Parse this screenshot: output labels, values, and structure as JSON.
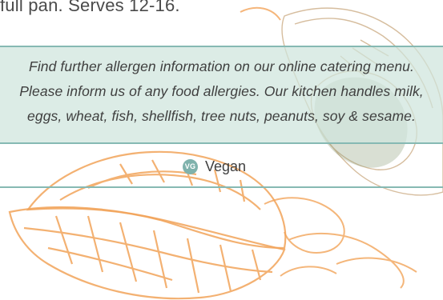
{
  "intro": {
    "serving_text": "full pan. Serves 12-16."
  },
  "allergen_notice": {
    "lines": [
      "Find further allergen information on our online catering menu.",
      "Please inform us of any food allergies. Our kitchen handles milk,",
      "eggs, wheat, fish, shellfish, tree nuts, peanuts, soy & sesame."
    ]
  },
  "legend": {
    "icon_text": "VG",
    "label": "Vegan"
  },
  "colors": {
    "notice_background": "#cee5dc",
    "rule_teal": "#86b9b3",
    "vegan_badge": "#7fb2ac",
    "sketch_orange": "#f2a45a",
    "text": "#3f3f3f"
  }
}
